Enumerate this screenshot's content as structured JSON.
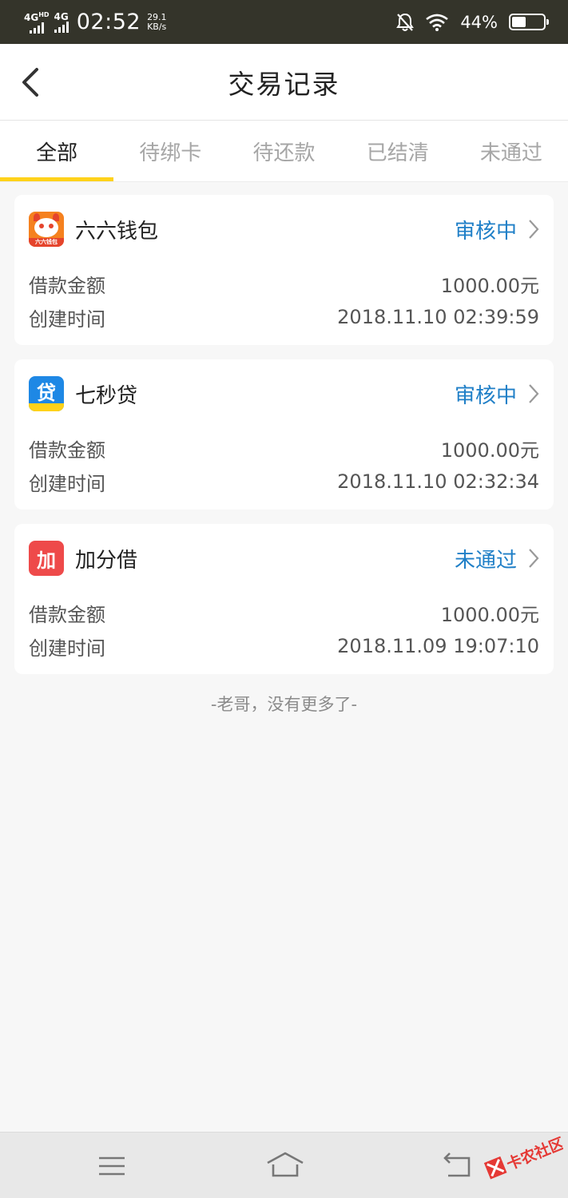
{
  "status_bar": {
    "network_1": "4G",
    "network_1_sup": "HD",
    "network_2": "4G",
    "time": "02:52",
    "speed_value": "29.1",
    "speed_unit": "KB/s",
    "battery_percent": "44%",
    "battery_level": 0.44
  },
  "header": {
    "title": "交易记录"
  },
  "tabs": [
    {
      "label": "全部",
      "active": true
    },
    {
      "label": "待绑卡",
      "active": false
    },
    {
      "label": "待还款",
      "active": false
    },
    {
      "label": "已结清",
      "active": false
    },
    {
      "label": "未通过",
      "active": false
    }
  ],
  "labels": {
    "amount": "借款金额",
    "created": "创建时间"
  },
  "records": [
    {
      "app_name": "六六钱包",
      "status": "审核中",
      "amount": "1000.00元",
      "created_at": "2018.11.10 02:39:59",
      "logo_text": "六六钱包",
      "logo_icon": "sixsix-wallet-icon"
    },
    {
      "app_name": "七秒贷",
      "status": "审核中",
      "amount": "1000.00元",
      "created_at": "2018.11.10 02:32:34",
      "logo_text": "贷",
      "logo_icon": "qimiaodai-icon"
    },
    {
      "app_name": "加分借",
      "status": "未通过",
      "amount": "1000.00元",
      "created_at": "2018.11.09 19:07:10",
      "logo_text": "加",
      "logo_icon": "jiafenjie-icon"
    }
  ],
  "end_note": "-老哥，没有更多了-",
  "watermark": {
    "text": "卡农社区"
  },
  "colors": {
    "accent": "#ffd21a",
    "status_blue": "#1f7fc7",
    "status_bar": "#34342a"
  }
}
